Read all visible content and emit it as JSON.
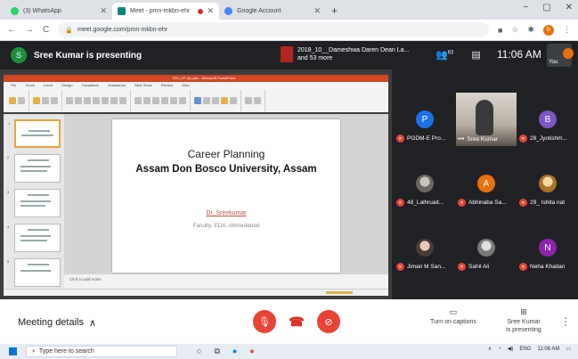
{
  "browser": {
    "tabs": [
      {
        "title": "(3) WhatsApp",
        "favicon_color": "#25d366",
        "active": false
      },
      {
        "title": "Meet - pmn-mkbn-ehr",
        "favicon_color": "#00897b",
        "active": true
      },
      {
        "title": "Google Account",
        "favicon_color": "#4285f4",
        "active": false
      }
    ],
    "new_tab": "+",
    "window_controls": {
      "minimize": "−",
      "restore": "▢",
      "close": "✕"
    },
    "url": "meet.google.com/pmn-mkbn-ehr"
  },
  "meet": {
    "presenter_initial": "S",
    "presenter_banner": "Sree Kumar is presenting",
    "others_line1": "2018_10__Dameshwa Daren Dean La...",
    "others_line2": "and 53 more",
    "participants_count": "63",
    "clock": "11:06 AM",
    "self_label": "You",
    "self_initial": "b"
  },
  "powerpoint": {
    "window_title": "EDI_CP (6).pptx - Microsoft PowerPoint",
    "ribbon_tabs": [
      "File",
      "Home",
      "Insert",
      "Design",
      "Transitions",
      "Animations",
      "Slide Show",
      "Review",
      "View"
    ],
    "notes_placeholder": "Click to add notes",
    "slide": {
      "title": "Career  Planning",
      "subtitle": "Assam Don Bosco University, Assam",
      "author": "Dr. Sreekumar",
      "affiliation": "Faculty, EDII, Ahmedabad"
    }
  },
  "participants": [
    {
      "name": "PGDM-E Pro...",
      "initial": "P",
      "color": "#1a73e8",
      "muted": true,
      "type": "initial"
    },
    {
      "name": "Sree Kumar",
      "initial": "",
      "color": "",
      "muted": false,
      "type": "video"
    },
    {
      "name": "28_Jyotishm...",
      "initial": "B",
      "color": "#7e57c2",
      "muted": true,
      "type": "initial"
    },
    {
      "name": "48_Lalhruait...",
      "initial": "",
      "color": "",
      "muted": true,
      "type": "photo"
    },
    {
      "name": "Abhinaba Sa...",
      "initial": "A",
      "color": "#e8710a",
      "muted": true,
      "type": "initial"
    },
    {
      "name": "29_ Ishita nat",
      "initial": "",
      "color": "",
      "muted": true,
      "type": "photo"
    },
    {
      "name": "Jiman M San...",
      "initial": "",
      "color": "",
      "muted": true,
      "type": "photo"
    },
    {
      "name": "Sahil Ali",
      "initial": "",
      "color": "",
      "muted": true,
      "type": "photo"
    },
    {
      "name": "Neha Khaitan",
      "initial": "N",
      "color": "#8e24aa",
      "muted": true,
      "type": "initial"
    }
  ],
  "controls": {
    "meeting_details": "Meeting details",
    "captions_label": "Turn on captions",
    "presenting_line1": "Sree Kumar",
    "presenting_line2": "is presenting",
    "more": "⋮"
  },
  "taskbar": {
    "search_placeholder": "Type here to search",
    "tray_lang": "ENG",
    "tray_time": "11:06 AM"
  },
  "colors": {
    "accent_red": "#ea4335",
    "meet_bg": "#202124",
    "ppt_orange": "#d24726"
  }
}
